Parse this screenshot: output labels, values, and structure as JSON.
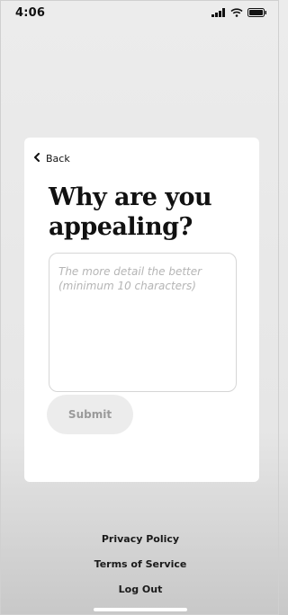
{
  "status_bar": {
    "time": "4:06",
    "icons": [
      "signal-icon",
      "wifi-icon",
      "battery-icon"
    ]
  },
  "card": {
    "back_label": "Back",
    "title": "Why are you appealing?",
    "textarea": {
      "value": "",
      "placeholder": "The more detail the better (minimum 10 characters)"
    },
    "submit_label": "Submit"
  },
  "footer": {
    "links": [
      "Privacy Policy",
      "Terms of Service",
      "Log Out"
    ]
  },
  "colors": {
    "background": "#e8e8e8",
    "card": "#ffffff",
    "submit_disabled_bg": "#ececec",
    "submit_disabled_text": "#9a9a9a"
  }
}
